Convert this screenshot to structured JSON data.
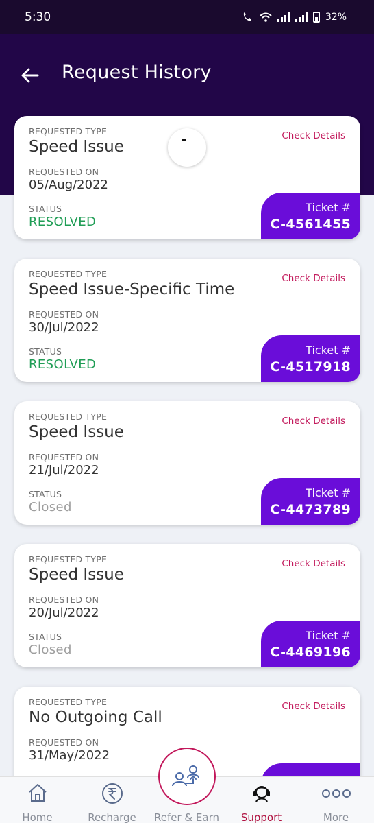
{
  "status_bar": {
    "time": "5:30",
    "battery": "32%"
  },
  "header": {
    "title": "Request History"
  },
  "labels": {
    "type": "REQUESTED TYPE",
    "date": "REQUESTED ON",
    "status": "STATUS",
    "check": "Check Details",
    "ticket": "Ticket #"
  },
  "requests": [
    {
      "type": "Speed Issue",
      "date": "05/Aug/2022",
      "status": "RESOLVED",
      "ticket": "C-4561455"
    },
    {
      "type": "Speed Issue-Specific Time",
      "date": "30/Jul/2022",
      "status": "RESOLVED",
      "ticket": "C-4517918"
    },
    {
      "type": "Speed Issue",
      "date": "21/Jul/2022",
      "status": "Closed",
      "ticket": "C-4473789"
    },
    {
      "type": "Speed Issue",
      "date": "20/Jul/2022",
      "status": "Closed",
      "ticket": "C-4469196"
    },
    {
      "type": "No Outgoing Call",
      "date": "31/May/2022",
      "status": "",
      "ticket": ""
    }
  ],
  "status_colors": {
    "RESOLVED": "#1f9d55",
    "Closed": "#9e9e9e"
  },
  "nav": [
    {
      "label": "Home",
      "icon": "home-icon"
    },
    {
      "label": "Recharge",
      "icon": "rupee-icon"
    },
    {
      "label": "Refer & Earn",
      "icon": "refer-icon"
    },
    {
      "label": "Support",
      "icon": "support-agent-icon",
      "active": true
    },
    {
      "label": "More",
      "icon": "more-dots-icon"
    }
  ],
  "colors": {
    "accent": "#6a0dd9",
    "header": "#220648",
    "link": "#c2185b"
  }
}
